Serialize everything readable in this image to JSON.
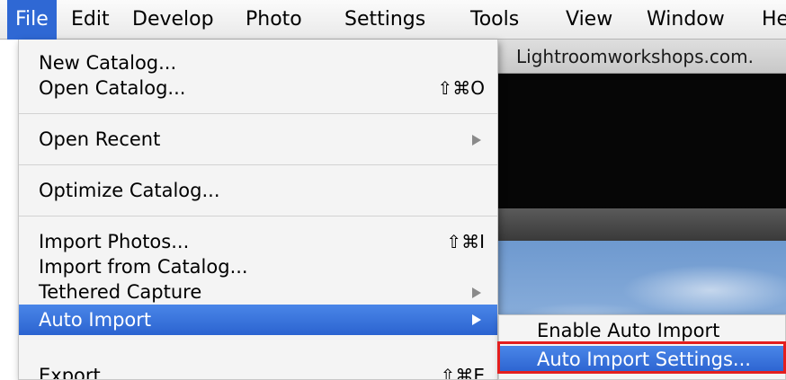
{
  "menubar": {
    "items": [
      "File",
      "Edit",
      "Develop",
      "Photo",
      "Settings",
      "Tools",
      "View",
      "Window",
      "He"
    ],
    "active": "File"
  },
  "window": {
    "title": "Lightroomworkshops.com."
  },
  "file_menu": {
    "new_catalog": "New Catalog...",
    "open_catalog": "Open Catalog...",
    "open_catalog_shortcut": "⇧⌘O",
    "open_recent": "Open Recent",
    "optimize_catalog": "Optimize Catalog...",
    "import_photos": "Import Photos...",
    "import_photos_shortcut": "⇧⌘I",
    "import_from_catalog": "Import from Catalog...",
    "tethered_capture": "Tethered Capture",
    "auto_import": "Auto Import",
    "export": "Export",
    "export_shortcut": "⇧⌘E"
  },
  "auto_import_submenu": {
    "enable_auto_import": "Enable Auto Import",
    "auto_import_settings": "Auto Import Settings..."
  },
  "colors": {
    "highlight": "#2f68d4",
    "callout": "#e41e1e"
  }
}
